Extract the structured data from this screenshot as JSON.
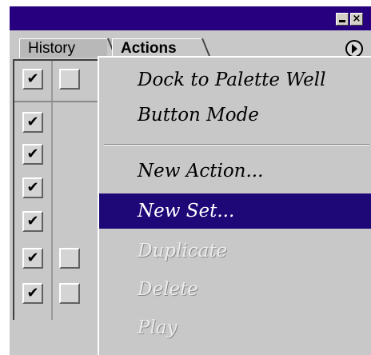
{
  "window": {
    "minimize_label": "",
    "close_label": "×"
  },
  "tabs": [
    {
      "label": "History",
      "active": false
    },
    {
      "label": "Actions",
      "active": true
    }
  ],
  "list_rows": [
    {
      "check": "✔",
      "col2": true
    },
    {
      "check": "✔",
      "col2": false
    },
    {
      "check": "✔",
      "col2": false
    },
    {
      "check": "✔",
      "col2": false
    },
    {
      "check": "✔",
      "col2": false
    },
    {
      "check": "✔",
      "col2": true
    },
    {
      "check": "✔",
      "col2": true
    }
  ],
  "menu": {
    "dock_to_palette_well": "Dock to Palette Well",
    "button_mode": "Button Mode",
    "new_action": "New Action...",
    "new_set": "New Set...",
    "duplicate": "Duplicate",
    "delete": "Delete",
    "play": "Play"
  },
  "colors": {
    "titlebar": "#26007e",
    "highlight": "#1e0878",
    "panel": "#c8c8c8"
  }
}
